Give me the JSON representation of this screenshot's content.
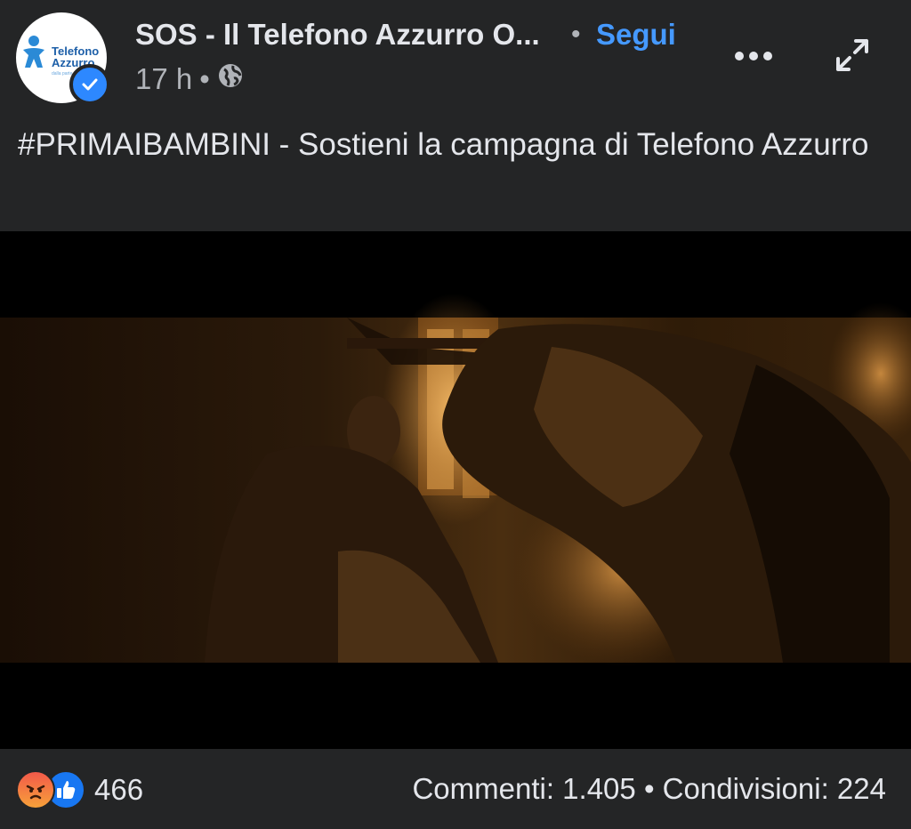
{
  "post": {
    "page_name": "SOS - Il Telefono Azzurro O...",
    "separator": "•",
    "follow_label": "Segui",
    "time": "17 h",
    "meta_separator": "•",
    "privacy_icon": "globe-icon",
    "avatar": {
      "logo_text_line1": "Telefono",
      "logo_text_line2": "Azzurro",
      "logo_tagline": "dalla parte dei bambini",
      "verified_icon": "verified-badge-icon"
    },
    "more_icon": "more-horizontal-icon",
    "expand_icon": "expand-icon",
    "caption": "#PRIMAIBAMBINI - Sostieni la campagna di Telefono Azzurro"
  },
  "footer": {
    "reaction_icons": [
      "angry-reaction-icon",
      "like-reaction-icon"
    ],
    "reaction_count": "466",
    "comments": "Commenti: 1.405",
    "stats_separator": "•",
    "shares": "Condivisioni: 224"
  },
  "colors": {
    "background": "#242526",
    "text": "#e4e6eb",
    "secondary_text": "#b0b3b8",
    "link_blue": "#4599ff",
    "verified_blue": "#2d88ff"
  }
}
